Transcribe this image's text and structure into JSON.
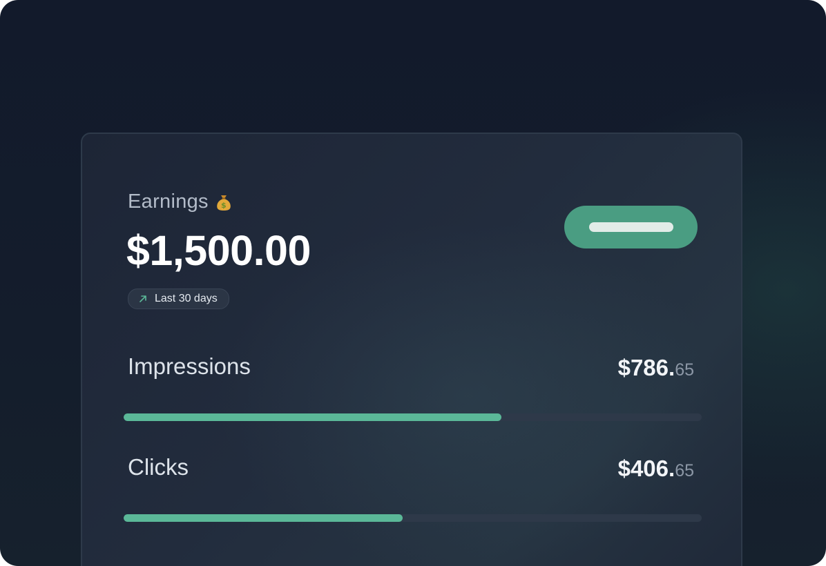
{
  "card": {
    "title": "Earnings",
    "title_icon": "money-bag-icon",
    "total": "$1,500.00",
    "period": {
      "label": "Last 30 days",
      "icon": "trend-up-arrow-icon"
    }
  },
  "metrics": [
    {
      "label": "Impressions",
      "value_main": "$786.",
      "value_cents": "65",
      "progress": 0.653
    },
    {
      "label": "Clicks",
      "value_main": "$406.",
      "value_cents": "65",
      "progress": 0.483
    }
  ],
  "colors": {
    "accent": "#4a9d82",
    "progress_fill": "#5bb898",
    "progress_track": "#2e3949",
    "background": "#121a2b",
    "card": "#1f2838"
  }
}
